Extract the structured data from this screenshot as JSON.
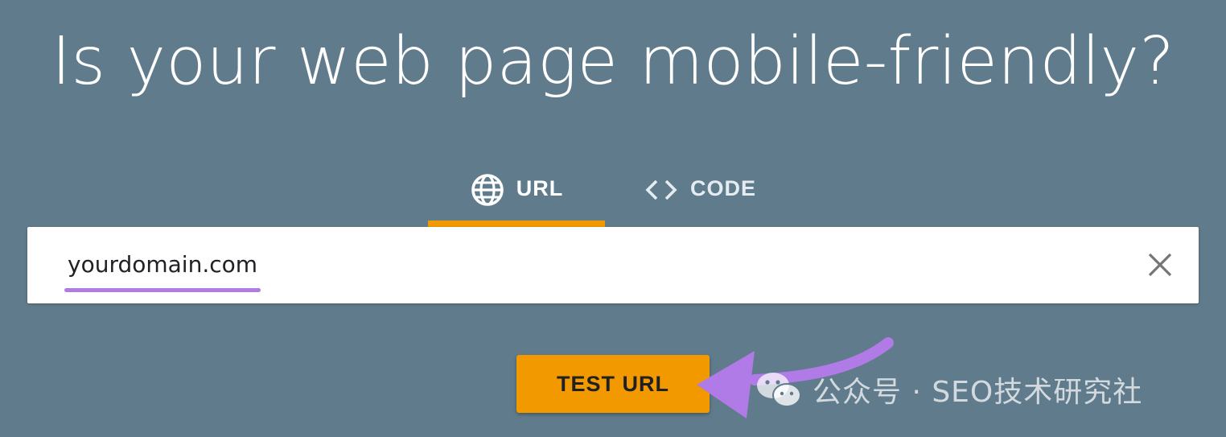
{
  "page": {
    "headline": "Is your web page mobile-friendly?"
  },
  "tabs": [
    {
      "label": "URL",
      "icon": "globe-icon",
      "active": true
    },
    {
      "label": "CODE",
      "icon": "code-brackets-icon",
      "active": false
    }
  ],
  "url_input": {
    "value": "yourdomain.com",
    "placeholder": "",
    "clear_icon": "close-icon"
  },
  "actions": {
    "test_button_label": "TEST URL"
  },
  "annotation": {
    "arrow_color": "#b07be6",
    "underline_color": "#b07be6"
  },
  "watermark": {
    "icon": "wechat-icon",
    "text": "公众号 · SEO技术研究社"
  },
  "colors": {
    "background": "#607b8b",
    "accent": "#f29900",
    "text_light": "#ffffff",
    "text_dark": "#202124"
  }
}
